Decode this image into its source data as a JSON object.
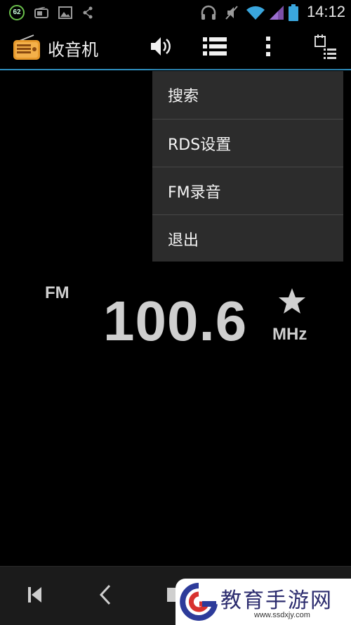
{
  "status_bar": {
    "badge_number": "62",
    "time": "14:12",
    "icons": [
      "notification-badge-icon",
      "radio-notification-icon",
      "image-notification-icon",
      "share-icon",
      "headphones-icon",
      "mute-icon",
      "wifi-icon",
      "signal-icon",
      "battery-icon"
    ]
  },
  "action_bar": {
    "title": "收音机",
    "icons": [
      "radio-app-icon",
      "speaker-icon",
      "channel-list-icon",
      "overflow-menu-icon",
      "schedule-list-icon"
    ]
  },
  "menu": {
    "items": [
      {
        "label": "搜索"
      },
      {
        "label": "RDS设置"
      },
      {
        "label": "FM录音"
      },
      {
        "label": "退出"
      }
    ]
  },
  "tuner": {
    "band": "FM",
    "frequency": "100.6",
    "unit": "MHz",
    "favorite_icon": "star-icon"
  },
  "controls": {
    "icons": [
      "skip-previous-icon",
      "tune-down-icon",
      "play-stop-icon"
    ]
  },
  "watermark": {
    "text": "教育手游网",
    "url": "www.ssdxjy.com"
  },
  "colors": {
    "accent": "#2f8fbf",
    "menu_bg": "#2c2c2c",
    "display_text": "#cfcfcf",
    "radio_orange": "#e89a2c"
  }
}
